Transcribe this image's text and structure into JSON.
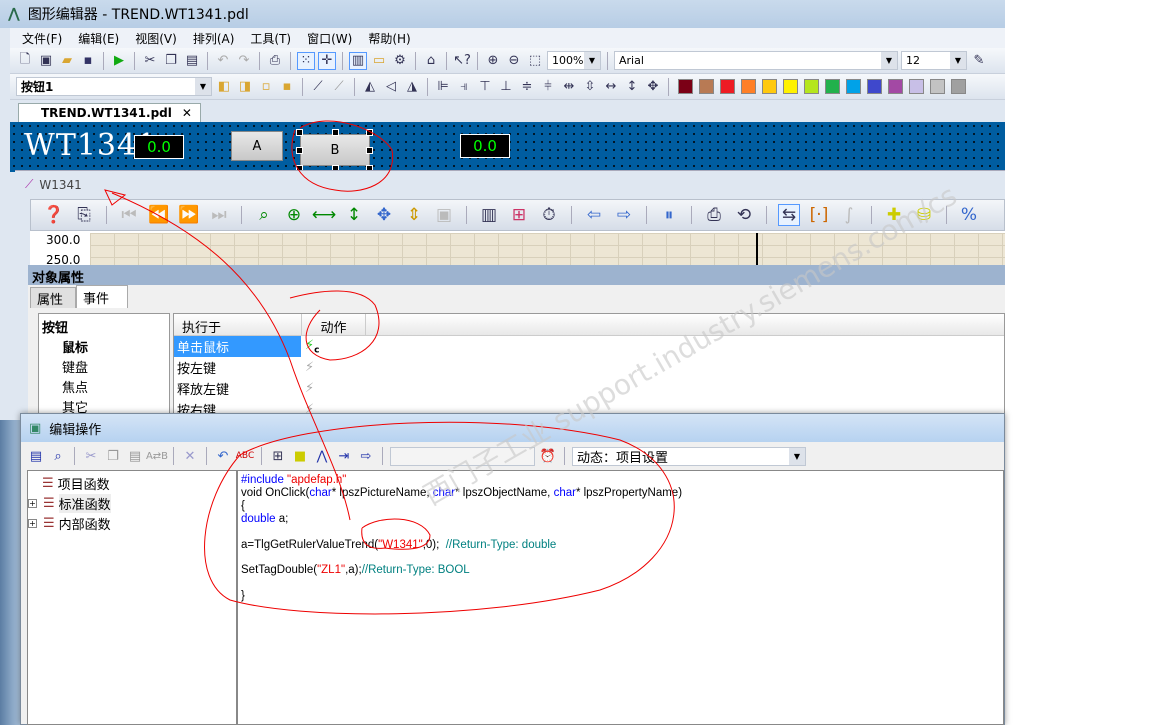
{
  "window": {
    "title": "图形编辑器 - TREND.WT1341.pdl"
  },
  "menu": [
    "文件(F)",
    "编辑(E)",
    "视图(V)",
    "排列(A)",
    "工具(T)",
    "窗口(W)",
    "帮助(H)"
  ],
  "toolbar": {
    "zoom": "100%",
    "font": "Arial",
    "font_size": "12",
    "object_select": "按钮1",
    "palette": [
      "#7b0016",
      "#b87a54",
      "#ee1c24",
      "#ff7f27",
      "#ffc90e",
      "#fff200",
      "#b5e61d",
      "#22b14c",
      "#00a2e8",
      "#3f48cc",
      "#a349a4",
      "#c8bfe7",
      "#c3c3c3",
      "#a0a0a0"
    ]
  },
  "doc_tab": "TREND.WT1341.pdl",
  "picture": {
    "title": "WT1341",
    "display_left": "0.0",
    "display_right": "0.0",
    "button_a": "A",
    "button_b": "B"
  },
  "trend": {
    "title": "W1341",
    "y_ticks": [
      "300.0",
      "250.0"
    ]
  },
  "props": {
    "header": "对象属性",
    "tabs": [
      "属性",
      "事件"
    ],
    "tree": {
      "root": "按钮",
      "items": [
        "鼠标",
        "键盘",
        "焦点",
        "其它"
      ]
    },
    "columns": [
      "执行于",
      "动作"
    ],
    "events": [
      "单击鼠标",
      "按左键",
      "释放左键",
      "按右键"
    ]
  },
  "dialog": {
    "title": "编辑操作",
    "trigger": "动态：项目设置",
    "functions": [
      "项目函数",
      "标准函数",
      "内部函数"
    ]
  },
  "code": [
    [
      [
        "kw",
        "#include "
      ],
      [
        "st",
        "\"apdefap.h\""
      ]
    ],
    [
      [
        "",
        "void OnClick("
      ],
      [
        "kw",
        "char"
      ],
      [
        "",
        "* lpszPictureName, "
      ],
      [
        "kw",
        "char"
      ],
      [
        "",
        "* lpszObjectName, "
      ],
      [
        "kw",
        "char"
      ],
      [
        "",
        "* lpszPropertyName)"
      ]
    ],
    [
      [
        "",
        "{"
      ]
    ],
    [
      [
        "kw",
        "double"
      ],
      [
        "",
        " a;"
      ]
    ],
    [
      [
        "",
        ""
      ]
    ],
    [
      [
        "",
        "a=TlgGetRulerValueTrend("
      ],
      [
        "st",
        "\"W1341\""
      ],
      [
        "",
        ",0);  "
      ],
      [
        "cm",
        "//Return-Type: double"
      ]
    ],
    [
      [
        "",
        ""
      ]
    ],
    [
      [
        "",
        "SetTagDouble("
      ],
      [
        "st",
        "\"ZL1\""
      ],
      [
        "",
        ",a);"
      ],
      [
        "cm",
        "//Return-Type: BOOL"
      ]
    ],
    [
      [
        "",
        ""
      ]
    ],
    [
      [
        "",
        "}"
      ]
    ]
  ]
}
